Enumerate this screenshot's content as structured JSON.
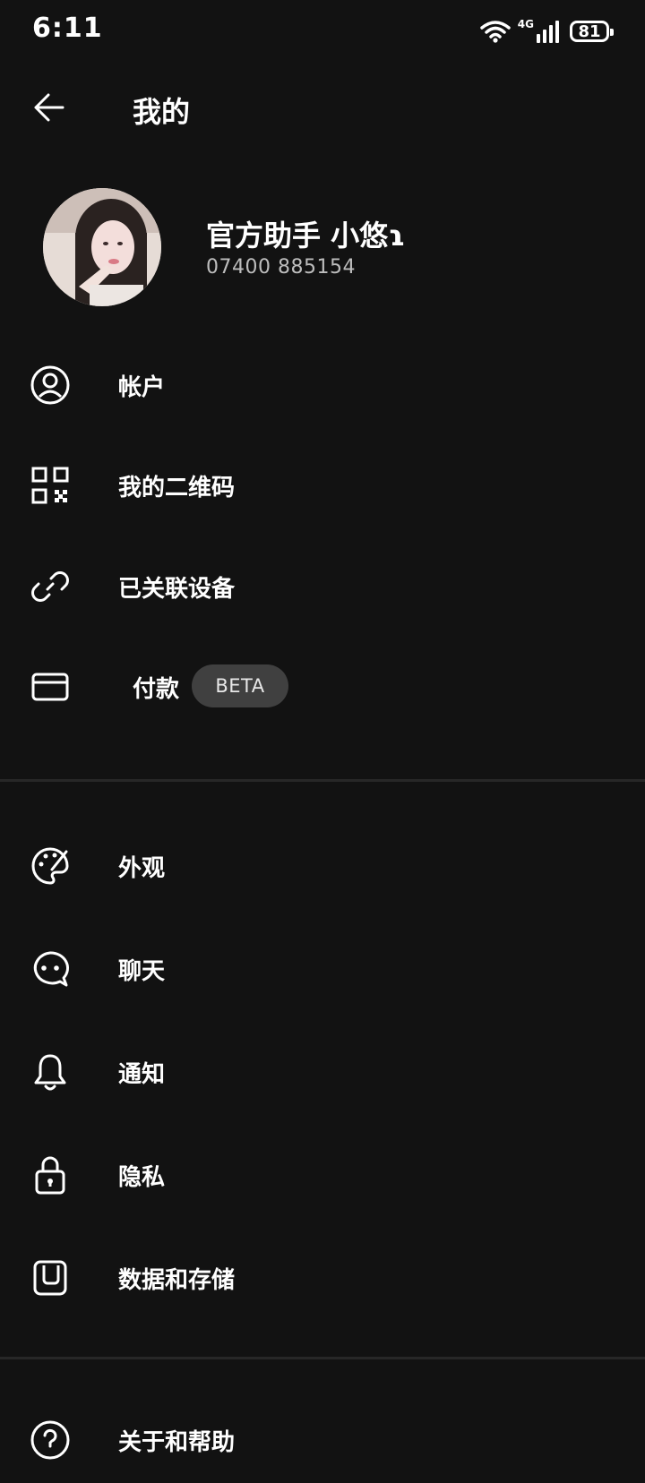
{
  "status_bar": {
    "time": "6:11",
    "network": "4G",
    "battery": "81"
  },
  "header": {
    "title": "我的"
  },
  "profile": {
    "name": "官方助手 小悠ɿ",
    "phone": "07400 885154"
  },
  "menu": {
    "account": "帐户",
    "qr_code": "我的二维码",
    "linked_devices": "已关联设备",
    "payments": "付款",
    "payments_badge": "BETA",
    "appearance": "外观",
    "chats": "聊天",
    "notifications": "通知",
    "privacy": "隐私",
    "data_storage": "数据和存储",
    "help": "关于和帮助"
  }
}
